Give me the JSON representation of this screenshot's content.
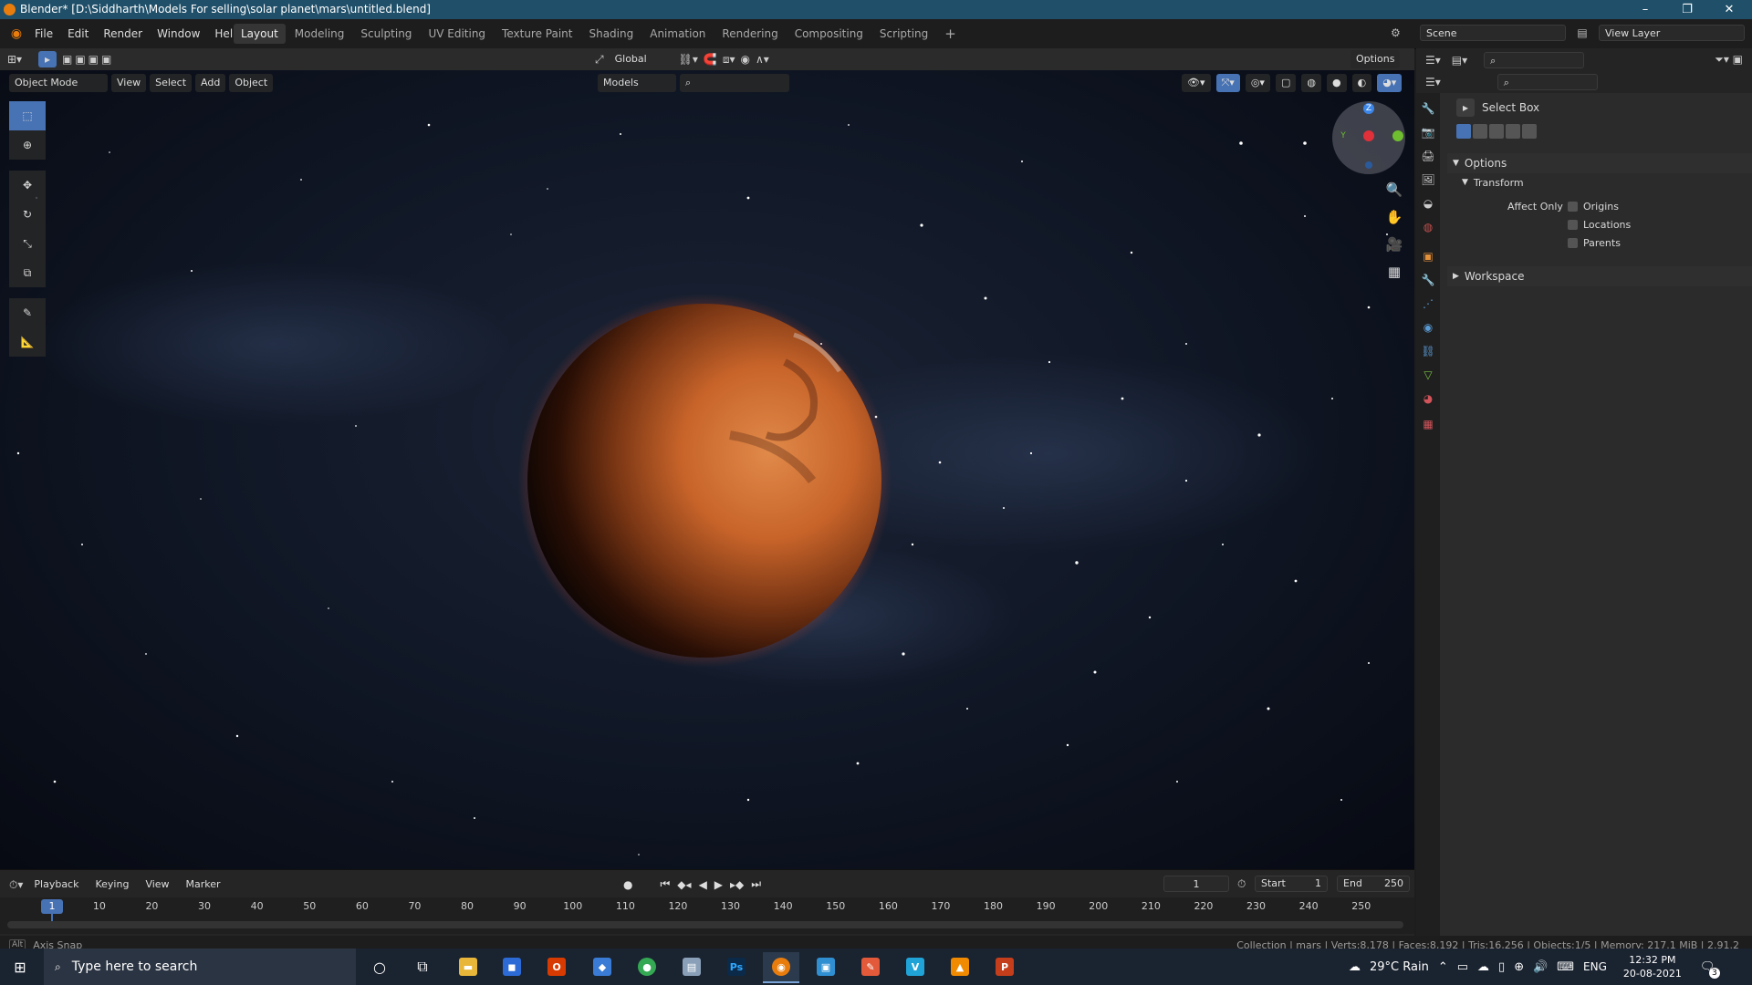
{
  "window": {
    "title": "Blender* [D:\\Siddharth\\Models For selling\\solar planet\\mars\\untitled.blend]",
    "minimize": "–",
    "restore": "❐",
    "close": "✕"
  },
  "menu": [
    "File",
    "Edit",
    "Render",
    "Window",
    "Help"
  ],
  "workspace_tabs": [
    {
      "label": "Layout",
      "active": true
    },
    {
      "label": "Modeling",
      "active": false
    },
    {
      "label": "Sculpting",
      "active": false
    },
    {
      "label": "UV Editing",
      "active": false
    },
    {
      "label": "Texture Paint",
      "active": false
    },
    {
      "label": "Shading",
      "active": false
    },
    {
      "label": "Animation",
      "active": false
    },
    {
      "label": "Rendering",
      "active": false
    },
    {
      "label": "Compositing",
      "active": false
    },
    {
      "label": "Scripting",
      "active": false
    }
  ],
  "add_workspace": "+",
  "scene": {
    "value": "Scene"
  },
  "view_layer": {
    "value": "View Layer"
  },
  "tool_header": {
    "orientation": "Global",
    "options_label": "Options"
  },
  "viewport_header": {
    "mode": "Object Mode",
    "menus": [
      "View",
      "Select",
      "Add",
      "Object"
    ],
    "models_label": "Models"
  },
  "gizmo": {
    "z": "Z",
    "y": "Y",
    "x": "X"
  },
  "properties": {
    "tool_name": "Select Box",
    "options_section": "Options",
    "transform_section": "Transform",
    "affect_only_label": "Affect Only",
    "checkboxes": [
      {
        "label": "Origins",
        "checked": false
      },
      {
        "label": "Locations",
        "checked": false
      },
      {
        "label": "Parents",
        "checked": false
      }
    ],
    "workspace_section": "Workspace"
  },
  "timeline": {
    "menus": [
      "Playback",
      "Keying",
      "View",
      "Marker"
    ],
    "current_frame": "1",
    "start_label": "Start",
    "start_value": "1",
    "end_label": "End",
    "end_value": "250",
    "ruler": [
      "1",
      "10",
      "20",
      "30",
      "40",
      "50",
      "60",
      "70",
      "80",
      "90",
      "100",
      "110",
      "120",
      "130",
      "140",
      "150",
      "160",
      "170",
      "180",
      "190",
      "200",
      "210",
      "220",
      "230",
      "240",
      "250"
    ]
  },
  "status": {
    "left": "Axis Snap",
    "right": "Collection | mars | Verts:8,178 | Faces:8,192 | Tris:16,256 | Objects:1/5 | Memory: 217.1 MiB | 2.91.2"
  },
  "taskbar": {
    "search_placeholder": "Type here to search",
    "weather": "29°C  Rain",
    "lang": "ENG",
    "time": "12:32 PM",
    "date": "20-08-2021",
    "notifications": "3"
  },
  "colors": {
    "accent": "#4772b3",
    "title_bar": "#1f4f69",
    "planet": "#c8642a"
  }
}
